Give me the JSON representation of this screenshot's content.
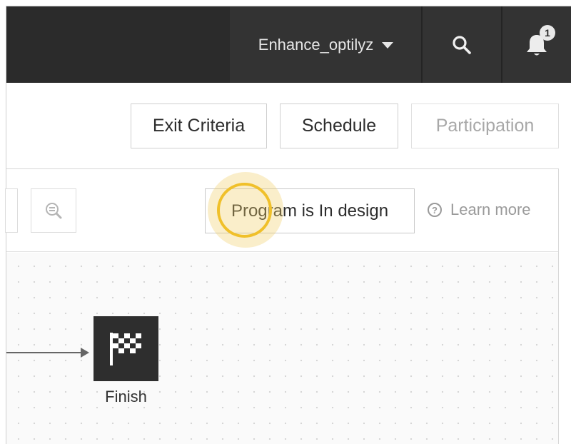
{
  "header": {
    "account_name": "Enhance_optilyz",
    "notification_count": "1",
    "icons": {
      "account_caret": "caret-down-icon",
      "search": "search-icon",
      "notifications": "bell-icon"
    }
  },
  "actions": {
    "exit_criteria": "Exit Criteria",
    "schedule": "Schedule",
    "participation": "Participation"
  },
  "toolbar": {
    "zoom_icon": "zoom-out-icon",
    "status": "Program is In design",
    "learn_more": "Learn more",
    "help_icon": "help-circle-icon"
  },
  "canvas": {
    "finish_node_label": "Finish",
    "finish_icon": "checkered-flag-icon"
  },
  "colors": {
    "topbar": "#2b2b2b",
    "highlight": "#f0c02a"
  }
}
